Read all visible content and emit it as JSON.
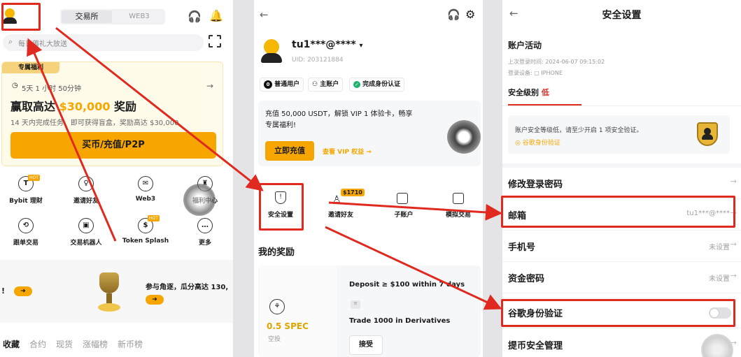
{
  "p1": {
    "tabs": [
      "交易所",
      "WEB3"
    ],
    "search_placeholder": "每日薅礼大放送",
    "promo_tag": "专属福利",
    "countdown": "5天 1 小时 50分钟",
    "promo_title_a": "赢取高达 ",
    "promo_amount": "$30,000",
    "promo_title_b": " 奖励",
    "promo_sub": "14 天内完成任务，即可获得盲盒，奖励高达 $30,000",
    "buy_button": "买币/充值/P2P",
    "grid": [
      {
        "label": "Bybit 理财",
        "badge": "HOT",
        "icon": "T"
      },
      {
        "label": "邀请好友",
        "badge": "",
        "icon": "♀"
      },
      {
        "label": "Web3",
        "badge": "",
        "icon": "✉"
      },
      {
        "label": "福利中心",
        "badge": "",
        "icon": "♜"
      },
      {
        "label": "跟单交易",
        "badge": "",
        "icon": "⟲"
      },
      {
        "label": "交易机器人",
        "badge": "",
        "icon": "▣"
      },
      {
        "label": "Token Splash",
        "badge": "HOT",
        "icon": "$"
      },
      {
        "label": "更多",
        "badge": "",
        "icon": "…"
      }
    ],
    "banner_left": "!",
    "banner_text": "参与角逐，瓜分高达 130,",
    "bottom_tabs": [
      "收藏",
      "合约",
      "现货",
      "涨幅榜",
      "新币榜"
    ],
    "colors": {
      "accent": "#f7a600",
      "red": "#e02a20"
    }
  },
  "p2": {
    "user_name": "tu1***@****",
    "uid": "UID: 203121884",
    "chips": [
      "普通用户",
      "主账户",
      "完成身份认证"
    ],
    "vip_text_1": "充值 50,000 USDT，解锁 VIP 1 体验卡，畅享",
    "vip_text_2": "专属福利!",
    "deposit_button": "立即充值",
    "vip_link": "查看 VIP 权益 →",
    "vip_side": "0",
    "shortcut_badge": "$1710",
    "shortcuts": [
      "安全设置",
      "邀请好友",
      "子账户",
      "模拟交易"
    ],
    "rewards_title": "我的奖励",
    "reward_amount": "0.5 SPEC",
    "reward_type": "空投",
    "task_1": "Deposit ≥ $100 within 7 days",
    "task_2": "Trade 1000 in Derivatives",
    "accept_button": "接受"
  },
  "p3": {
    "title": "安全设置",
    "activity_title": "账户活动",
    "last_login": "上次登录时间: 2024-06-07 09:15:02",
    "login_device": "登录设备: ▢ IPHONE",
    "level_label": "安全级别",
    "level_value": "低",
    "notice_text": "账户安全等级低，请至少开启 1 项安全验证。",
    "notice_link": "谷歌身份验证",
    "rows": [
      {
        "label": "修改登录密码",
        "value": ""
      },
      {
        "label": "邮箱",
        "value": "tu1***@****"
      },
      {
        "label": "手机号",
        "value": "未设置"
      },
      {
        "label": "资金密码",
        "value": "未设置"
      },
      {
        "label": "谷歌身份验证",
        "value": ""
      },
      {
        "label": "提币安全管理",
        "value": ""
      }
    ]
  }
}
